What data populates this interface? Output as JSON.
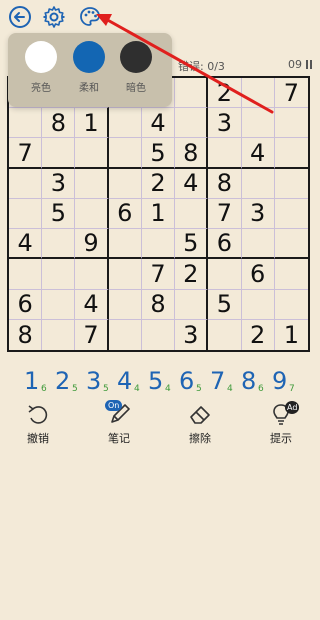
{
  "topbar": {
    "back_icon": "back-arrow-icon",
    "settings_icon": "gear-icon",
    "palette_icon": "palette-icon"
  },
  "status": {
    "mistakes": "错误: 0/3",
    "timer": "09"
  },
  "theme_popup": {
    "options": [
      {
        "label": "亮色",
        "color": "#ffffff"
      },
      {
        "label": "柔和",
        "color": "#1366b3"
      },
      {
        "label": "暗色",
        "color": "#2f2f2f"
      }
    ]
  },
  "board": {
    "rows": [
      [
        "",
        "",
        "",
        "",
        "",
        "",
        "2",
        "",
        "7"
      ],
      [
        "",
        "8",
        "1",
        "",
        "4",
        "",
        "3",
        "",
        ""
      ],
      [
        "7",
        "",
        "",
        "",
        "5",
        "8",
        "",
        "4",
        ""
      ],
      [
        "",
        "3",
        "",
        "",
        "2",
        "4",
        "8",
        "",
        ""
      ],
      [
        "",
        "5",
        "",
        "6",
        "1",
        "",
        "7",
        "3",
        ""
      ],
      [
        "4",
        "",
        "9",
        "",
        "",
        "5",
        "6",
        "",
        ""
      ],
      [
        "",
        "",
        "",
        "",
        "7",
        "2",
        "",
        "6",
        ""
      ],
      [
        "6",
        "",
        "4",
        "",
        "8",
        "",
        "5",
        "",
        ""
      ],
      [
        "8",
        "",
        "7",
        "",
        "",
        "3",
        "",
        "2",
        "1"
      ]
    ]
  },
  "numpad": {
    "keys": [
      {
        "digit": "1",
        "remaining": "6"
      },
      {
        "digit": "2",
        "remaining": "5"
      },
      {
        "digit": "3",
        "remaining": "5"
      },
      {
        "digit": "4",
        "remaining": "4"
      },
      {
        "digit": "5",
        "remaining": "4"
      },
      {
        "digit": "6",
        "remaining": "5"
      },
      {
        "digit": "7",
        "remaining": "4"
      },
      {
        "digit": "8",
        "remaining": "6"
      },
      {
        "digit": "9",
        "remaining": "7"
      }
    ]
  },
  "toolbar": {
    "undo_label": "撤销",
    "notes_label": "笔记",
    "notes_badge": "On",
    "erase_label": "擦除",
    "hint_label": "提示",
    "hint_badge": "Ad"
  },
  "colors": {
    "accent": "#1e64b4",
    "arrow": "#e0201e",
    "count": "#3f9a3a"
  }
}
